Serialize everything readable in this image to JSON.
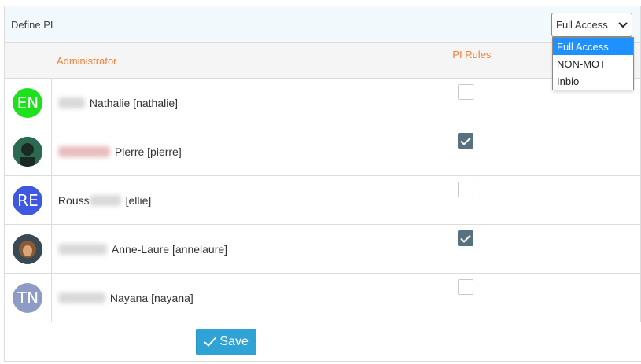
{
  "header": {
    "title": "Define PI",
    "select_value": "Full Access"
  },
  "columns": {
    "administrator": "Administrator",
    "pi_rules": "PI Rules"
  },
  "users": [
    {
      "initials": "EN",
      "avatar_color": "#1ee11e",
      "name": "Nathalie [nathalie]",
      "checked": false
    },
    {
      "initials": "",
      "avatar_color": "#2b6a50",
      "name": "Pierre [pierre]",
      "checked": true
    },
    {
      "initials": "RE",
      "avatar_color": "#3f58e0",
      "name_prefix": "Rouss",
      "name": "[ellie]",
      "checked": false
    },
    {
      "initials": "",
      "avatar_color": "#6a4b35",
      "name": "Anne-Laure [annelaure]",
      "checked": true
    },
    {
      "initials": "TN",
      "avatar_color": "#8e9cc5",
      "name": "Nayana [nayana]",
      "checked": false
    }
  ],
  "dropdown": {
    "options": [
      "Full Access",
      "NON-MOT",
      "Inbio"
    ],
    "selected": "Full Access"
  },
  "footer": {
    "save_label": "Save"
  },
  "colors": {
    "accent_orange": "#f0813b",
    "save_blue": "#2fa3d5",
    "checked_fill": "#587181",
    "header_bg": "#f1f9fd"
  }
}
